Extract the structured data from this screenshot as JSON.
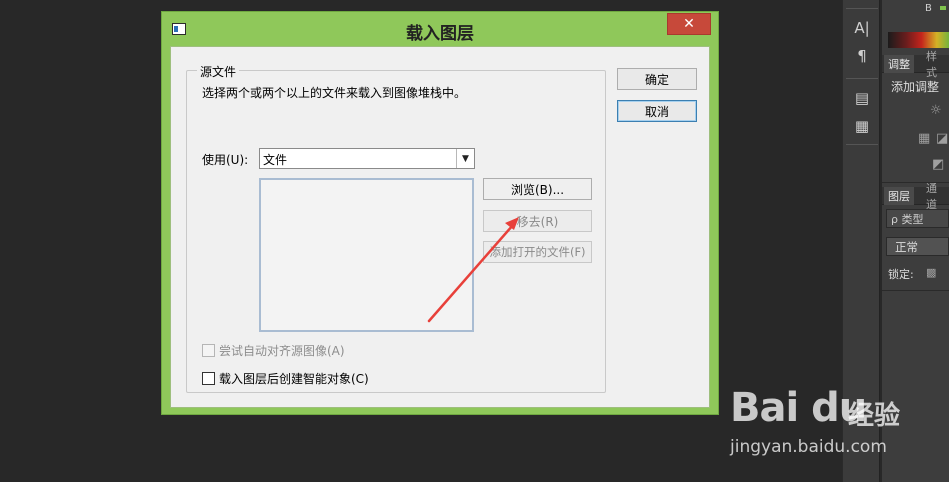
{
  "dialog": {
    "title": "载入图层",
    "close_glyph": "✕",
    "group_title": "源文件",
    "description": "选择两个或两个以上的文件来载入到图像堆栈中。",
    "use_label": "使用(U):",
    "use_value": "文件",
    "browse_label": "浏览(B)...",
    "remove_label": "移去(R)",
    "add_open_label": "添加打开的文件(F)",
    "auto_align_label": "尝试自动对齐源图像(A)",
    "smart_object_label": "载入图层后创建智能对象(C)",
    "ok_label": "确定",
    "cancel_label": "取消"
  },
  "tool_strip": {
    "icons": [
      "character-icon",
      "paragraph-icon",
      "swatch-book-icon",
      "notes-icon"
    ]
  },
  "panel": {
    "channel_letter": "B",
    "tab_adjust": "调整",
    "tab_style": "样式",
    "add_adjustment": "添加调整",
    "tab_layers": "图层",
    "tab_channels": "通道",
    "search_label": "ρ 类型",
    "blend_mode": "正常",
    "lock_label": "锁定:"
  },
  "watermark": {
    "logo": "Bai du",
    "cn": "经验",
    "url": "jingyan.baidu.com"
  },
  "colors": {
    "dialog_frame": "#8fc85a",
    "close_red": "#c7493a",
    "arrow_red": "#e8403a",
    "app_bg": "#282828"
  }
}
